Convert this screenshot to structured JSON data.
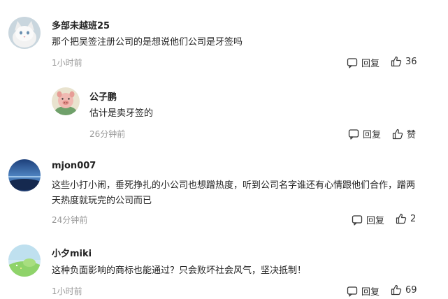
{
  "comments": [
    {
      "username": "多部未越班25",
      "text": "那个把吴签注册公司的是想说他们公司是牙签吗",
      "time": "1小时前",
      "reply_label": "回复",
      "like_label": "36",
      "avatar_icon": "white-cat-avatar"
    },
    {
      "username": "公子鹏",
      "text": "估计是卖牙签的",
      "time": "26分钟前",
      "reply_label": "回复",
      "like_label": "赞",
      "avatar_icon": "pig-avatar"
    },
    {
      "username": "mjon007",
      "text": "这些小打小闹，垂死挣扎的小公司也想蹭热度，听到公司名字谁还有心情跟他们合作，蹭两天热度就玩完的公司而已",
      "time": "24分钟前",
      "reply_label": "回复",
      "like_label": "2",
      "avatar_icon": "lake-landscape-avatar"
    },
    {
      "username": "小夕miki",
      "text": "这种负面影响的商标也能通过？只会败坏社会风气，坚决抵制！",
      "time": "1小时前",
      "reply_label": "回复",
      "like_label": "69",
      "avatar_icon": "green-field-avatar"
    }
  ],
  "colors": {
    "text": "#222222",
    "meta": "#999999",
    "action": "#333333"
  }
}
